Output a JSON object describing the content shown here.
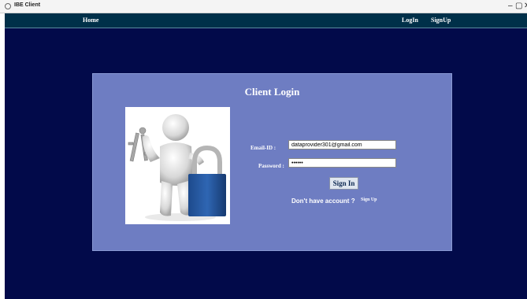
{
  "window": {
    "title": "IBE Client",
    "controls": [
      "–",
      "▢",
      "✕"
    ]
  },
  "nav": {
    "home": "Home",
    "login": "LogIn",
    "signup": "SignUp"
  },
  "panel": {
    "title": "Client Login"
  },
  "form": {
    "email_label": "Email-ID :",
    "email_value": "dataprovider301@gmail.com",
    "password_label": "Password :",
    "password_value": "secret",
    "signin_label": "Sign In",
    "no_account_text": "Don't have account ?",
    "signup_link": "Sign Up"
  },
  "colors": {
    "nav_bar": "#003049",
    "background": "#020a4a",
    "panel": "#6e7dc2",
    "lock": "#2c5aa0"
  },
  "illustration": {
    "icon": "user-with-keys-and-padlock-icon"
  }
}
